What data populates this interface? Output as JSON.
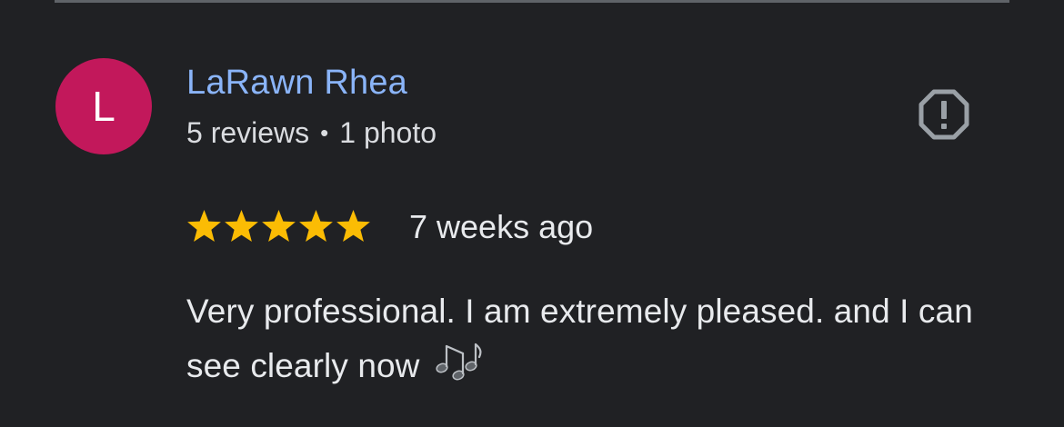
{
  "review": {
    "avatar_initial": "L",
    "author_name": "LaRawn Rhea",
    "reviews_count": "5 reviews",
    "separator": "•",
    "photos_count": "1 photo",
    "rating": 5,
    "max_rating": 5,
    "time_ago": "7 weeks ago",
    "text": "Very professional. I am extremely pleased. and I can see clearly now"
  },
  "icons": {
    "report": "report-octagon-icon",
    "star": "star-icon",
    "emoji": "musical-notes-icon"
  },
  "colors": {
    "background": "#202124",
    "avatar": "#c2185b",
    "author_name": "#8ab4f8",
    "star": "#fbbc04",
    "text": "#e8eaed",
    "icon": "#9aa0a6"
  }
}
